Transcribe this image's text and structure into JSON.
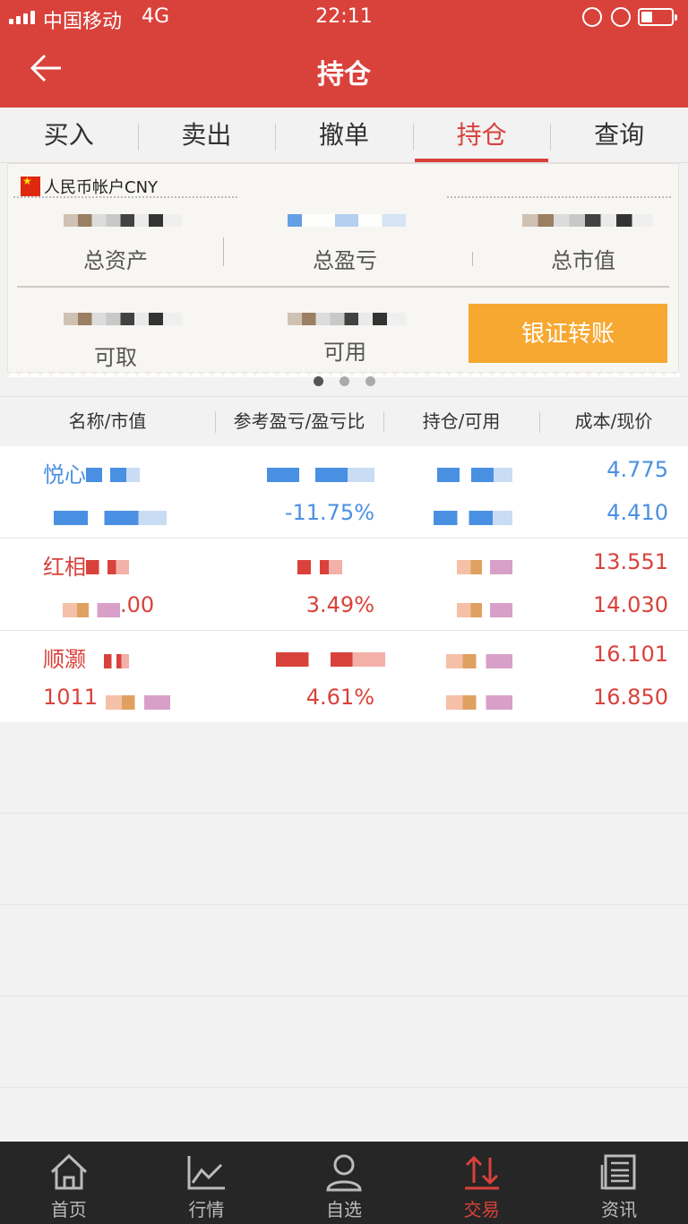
{
  "status": {
    "carrier": "中国移动",
    "network": "4G",
    "time": "22:11"
  },
  "nav": {
    "title": "持仓"
  },
  "tabs": [
    {
      "label": "买入",
      "active": false
    },
    {
      "label": "卖出",
      "active": false
    },
    {
      "label": "撤单",
      "active": false
    },
    {
      "label": "持仓",
      "active": true
    },
    {
      "label": "查询",
      "active": false
    }
  ],
  "account": {
    "label": "人民币帐户CNY",
    "stats": {
      "total_assets": "总资产",
      "total_pl": "总盈亏",
      "market_value": "总市值",
      "withdrawable": "可取",
      "available": "可用"
    },
    "transfer_button": "银证转账"
  },
  "table": {
    "headers": [
      "名称/市值",
      "参考盈亏/盈亏比",
      "持仓/可用",
      "成本/现价"
    ],
    "rows": [
      {
        "name": "悦心",
        "value": "",
        "pl": "",
        "pl_ratio": "-11.75%",
        "cost": "4.775",
        "price": "4.410",
        "color": "blue"
      },
      {
        "name": "红相",
        "value": ".00",
        "pl": "",
        "pl_ratio": "3.49%",
        "cost": "13.551",
        "price": "14.030",
        "color": "red"
      },
      {
        "name": "顺灏",
        "value": "1011",
        "pl": "",
        "pl_ratio": "4.61%",
        "cost": "16.101",
        "price": "16.850",
        "color": "red"
      }
    ]
  },
  "tabbar": [
    {
      "label": "首页",
      "icon": "home-icon",
      "active": false
    },
    {
      "label": "行情",
      "icon": "chart-icon",
      "active": false
    },
    {
      "label": "自选",
      "icon": "person-icon",
      "active": false
    },
    {
      "label": "交易",
      "icon": "trade-icon",
      "active": true
    },
    {
      "label": "资讯",
      "icon": "news-icon",
      "active": false
    }
  ],
  "colors": {
    "brand": "#d9423b",
    "accent": "#f7a831",
    "loss": "#4a90e2",
    "gain": "#d9423b"
  }
}
